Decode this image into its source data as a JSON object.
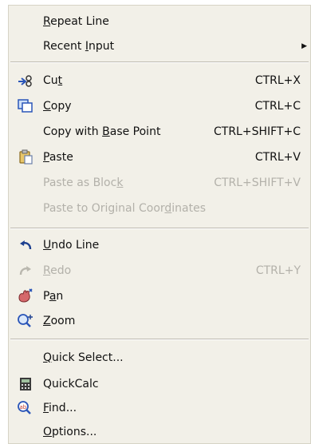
{
  "menu": {
    "items": [
      {
        "pre": "",
        "key": "R",
        "post": "epeat Line",
        "shortcut": "",
        "icon": "",
        "disabled": false,
        "submenu": false
      },
      {
        "pre": "Recent ",
        "key": "I",
        "post": "nput",
        "shortcut": "",
        "icon": "",
        "disabled": false,
        "submenu": true
      },
      {
        "pre": "Cu",
        "key": "t",
        "post": "",
        "shortcut": "CTRL+X",
        "icon": "scissors-icon",
        "disabled": false,
        "submenu": false
      },
      {
        "pre": "",
        "key": "C",
        "post": "opy",
        "shortcut": "CTRL+C",
        "icon": "copy-icon",
        "disabled": false,
        "submenu": false
      },
      {
        "pre": "Copy with ",
        "key": "B",
        "post": "ase Point",
        "shortcut": "CTRL+SHIFT+C",
        "icon": "",
        "disabled": false,
        "submenu": false
      },
      {
        "pre": "",
        "key": "P",
        "post": "aste",
        "shortcut": "CTRL+V",
        "icon": "paste-icon",
        "disabled": false,
        "submenu": false
      },
      {
        "pre": "Paste as Bloc",
        "key": "k",
        "post": "",
        "shortcut": "CTRL+SHIFT+V",
        "icon": "",
        "disabled": true,
        "submenu": false
      },
      {
        "pre": "Paste to Original Coor",
        "key": "d",
        "post": "inates",
        "shortcut": "",
        "icon": "",
        "disabled": true,
        "submenu": false
      },
      {
        "pre": "",
        "key": "U",
        "post": "ndo Line",
        "shortcut": "",
        "icon": "undo-icon",
        "disabled": false,
        "submenu": false
      },
      {
        "pre": "",
        "key": "R",
        "post": "edo",
        "shortcut": "CTRL+Y",
        "icon": "redo-icon",
        "disabled": true,
        "submenu": false
      },
      {
        "pre": "P",
        "key": "a",
        "post": "n",
        "shortcut": "",
        "icon": "pan-icon",
        "disabled": false,
        "submenu": false
      },
      {
        "pre": "",
        "key": "Z",
        "post": "oom",
        "shortcut": "",
        "icon": "zoom-icon",
        "disabled": false,
        "submenu": false
      },
      {
        "pre": "",
        "key": "Q",
        "post": "uick Select...",
        "shortcut": "",
        "icon": "",
        "disabled": false,
        "submenu": false
      },
      {
        "pre": "QuickCalc",
        "key": "",
        "post": "",
        "shortcut": "",
        "icon": "calculator-icon",
        "disabled": false,
        "submenu": false
      },
      {
        "pre": "",
        "key": "F",
        "post": "ind...",
        "shortcut": "",
        "icon": "find-icon",
        "disabled": false,
        "submenu": false
      },
      {
        "pre": "",
        "key": "O",
        "post": "ptions...",
        "shortcut": "",
        "icon": "",
        "disabled": false,
        "submenu": false
      }
    ]
  }
}
